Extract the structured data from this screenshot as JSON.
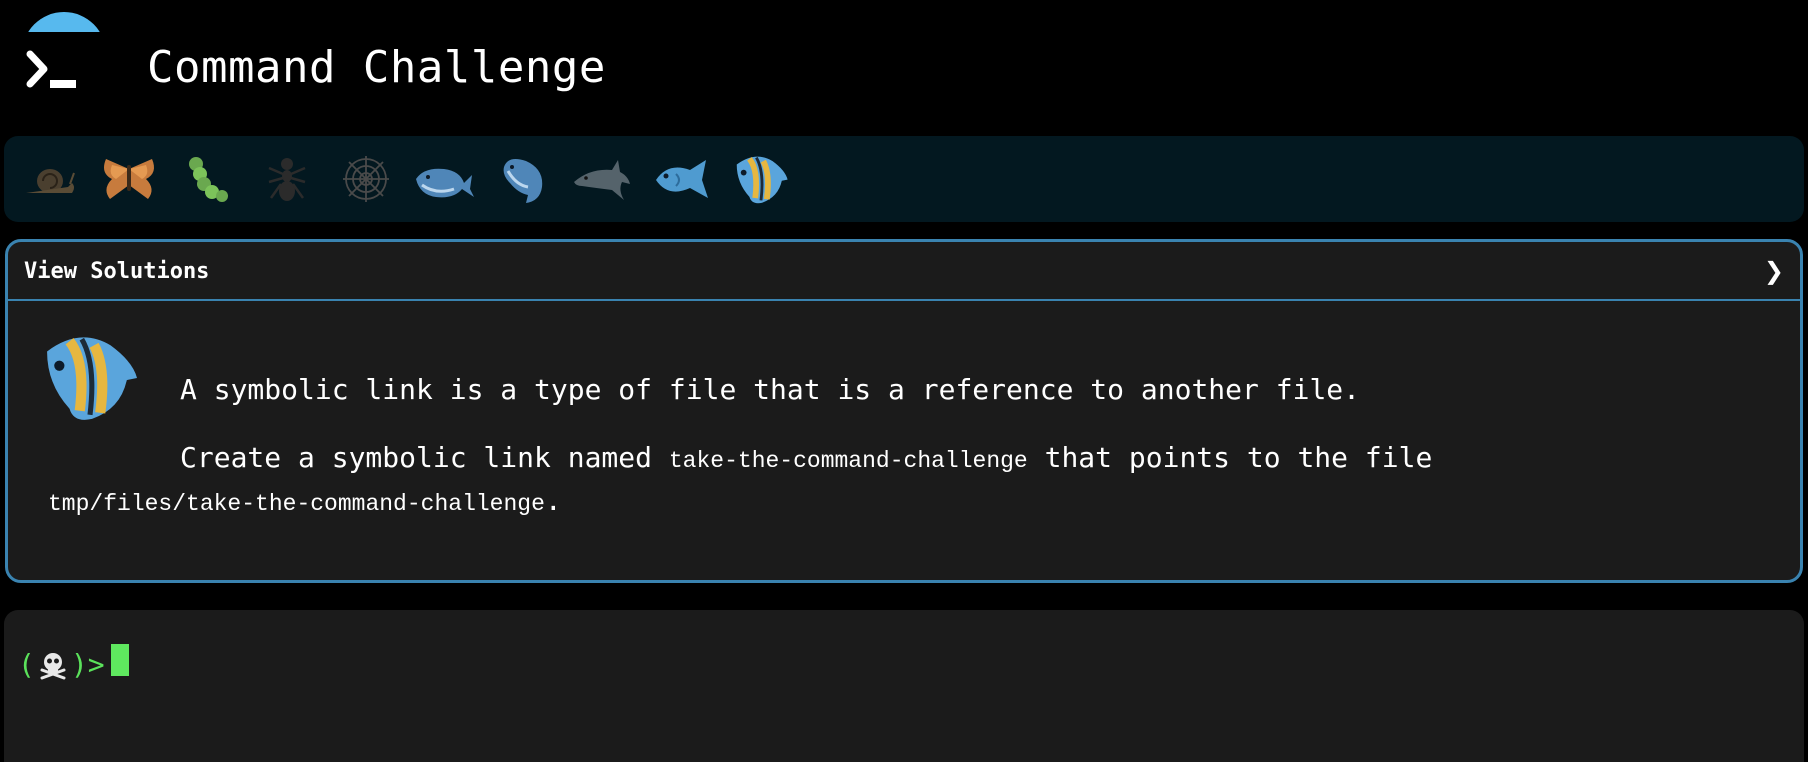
{
  "header": {
    "title": "Command Challenge",
    "logo_icon": "terminal-prompt-icon",
    "accent": "#57b9ee"
  },
  "levels": [
    {
      "icon": "snail-icon",
      "state": "dim"
    },
    {
      "icon": "butterfly-icon",
      "state": "done"
    },
    {
      "icon": "caterpillar-icon",
      "state": "done"
    },
    {
      "icon": "ant-icon",
      "state": "dim"
    },
    {
      "icon": "spider-web-icon",
      "state": "dim"
    },
    {
      "icon": "whale-icon",
      "state": "done"
    },
    {
      "icon": "spouting-whale-icon",
      "state": "done"
    },
    {
      "icon": "dolphin-icon",
      "state": "dim"
    },
    {
      "icon": "fish-icon",
      "state": "done"
    },
    {
      "icon": "tropical-fish-icon",
      "state": "current"
    }
  ],
  "challenge": {
    "toggle_label": "View Solutions",
    "chevron": "❯",
    "level_icon": "tropical-fish-icon",
    "paragraph1": "A symbolic link is a type of file that is a reference to another file.",
    "paragraph2_prefix": "Create a symbolic link named ",
    "paragraph2_code": "take-the-command-challenge",
    "paragraph2_suffix": " that points to the file",
    "paragraph2_path": "tmp/files/take-the-command-challenge",
    "paragraph2_end": "."
  },
  "terminal": {
    "prompt_open": "(",
    "prompt_icon": "skull-crossbones-icon",
    "prompt_close": ")>",
    "input_value": "",
    "prompt_color": "#5be25b"
  }
}
